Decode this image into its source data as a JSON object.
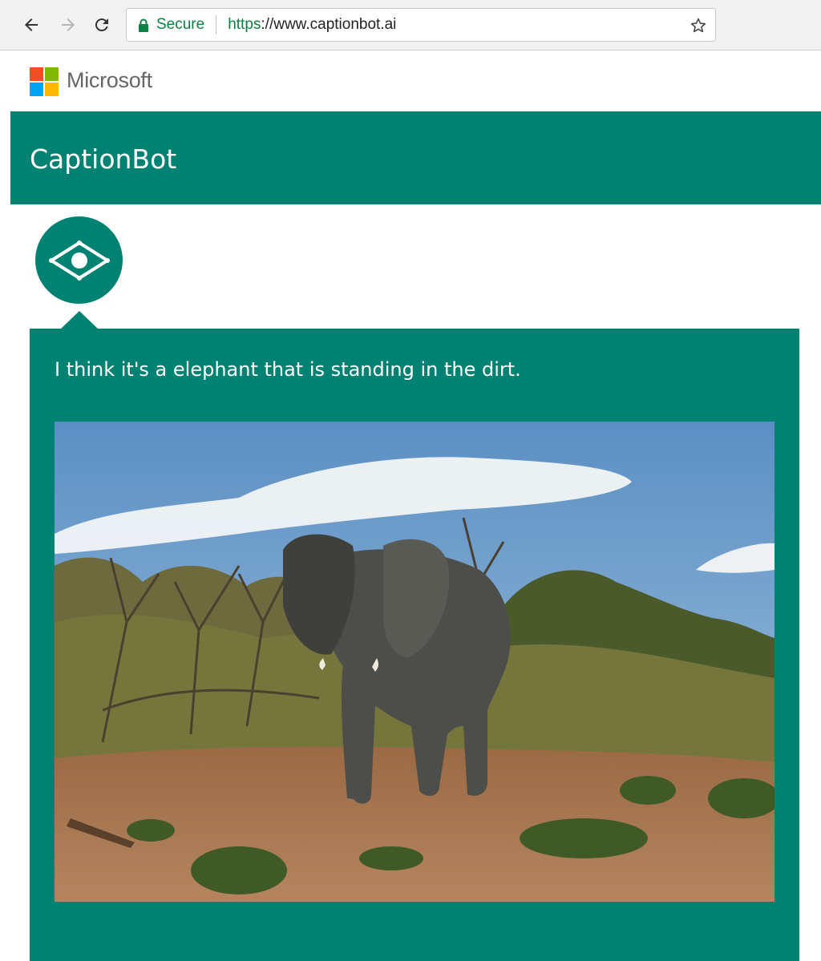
{
  "browser": {
    "secure_label": "Secure",
    "url_scheme": "https",
    "url_rest": "://www.captionbot.ai",
    "icons": [
      "back-icon",
      "forward-icon",
      "reload-icon",
      "lock-icon",
      "star-icon"
    ]
  },
  "header": {
    "brand_name": "Microsoft",
    "logo_colors": [
      "#f25022",
      "#7fba00",
      "#00a4ef",
      "#ffb900"
    ]
  },
  "banner": {
    "title": "CaptionBot",
    "color": "#008272"
  },
  "bot": {
    "avatar_icon": "eye-icon"
  },
  "result": {
    "caption": "I think it's a elephant that is standing in the dirt.",
    "image_alt_subject": "elephant"
  }
}
